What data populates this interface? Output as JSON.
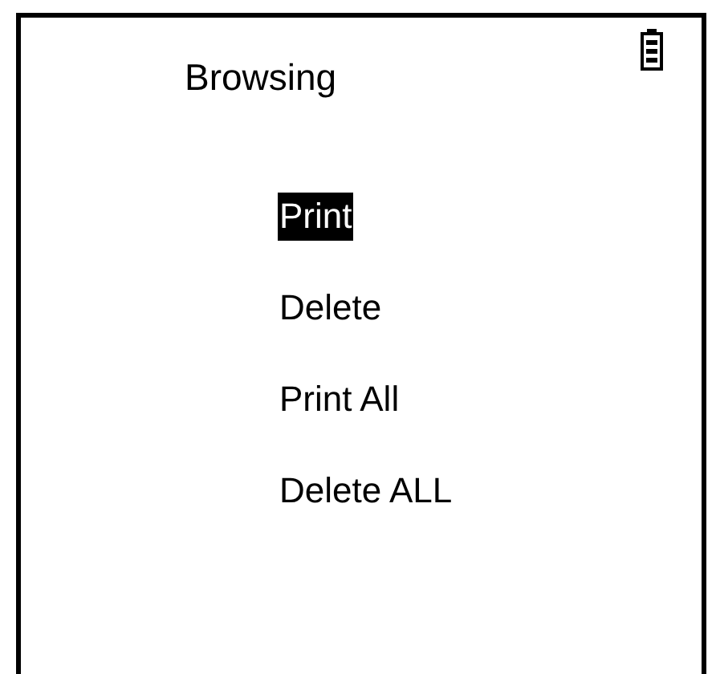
{
  "title": "Browsing",
  "menu": [
    {
      "label": "Print",
      "selected": true
    },
    {
      "label": "Delete",
      "selected": false
    },
    {
      "label": "Print All",
      "selected": false
    },
    {
      "label": "Delete ALL",
      "selected": false
    }
  ]
}
